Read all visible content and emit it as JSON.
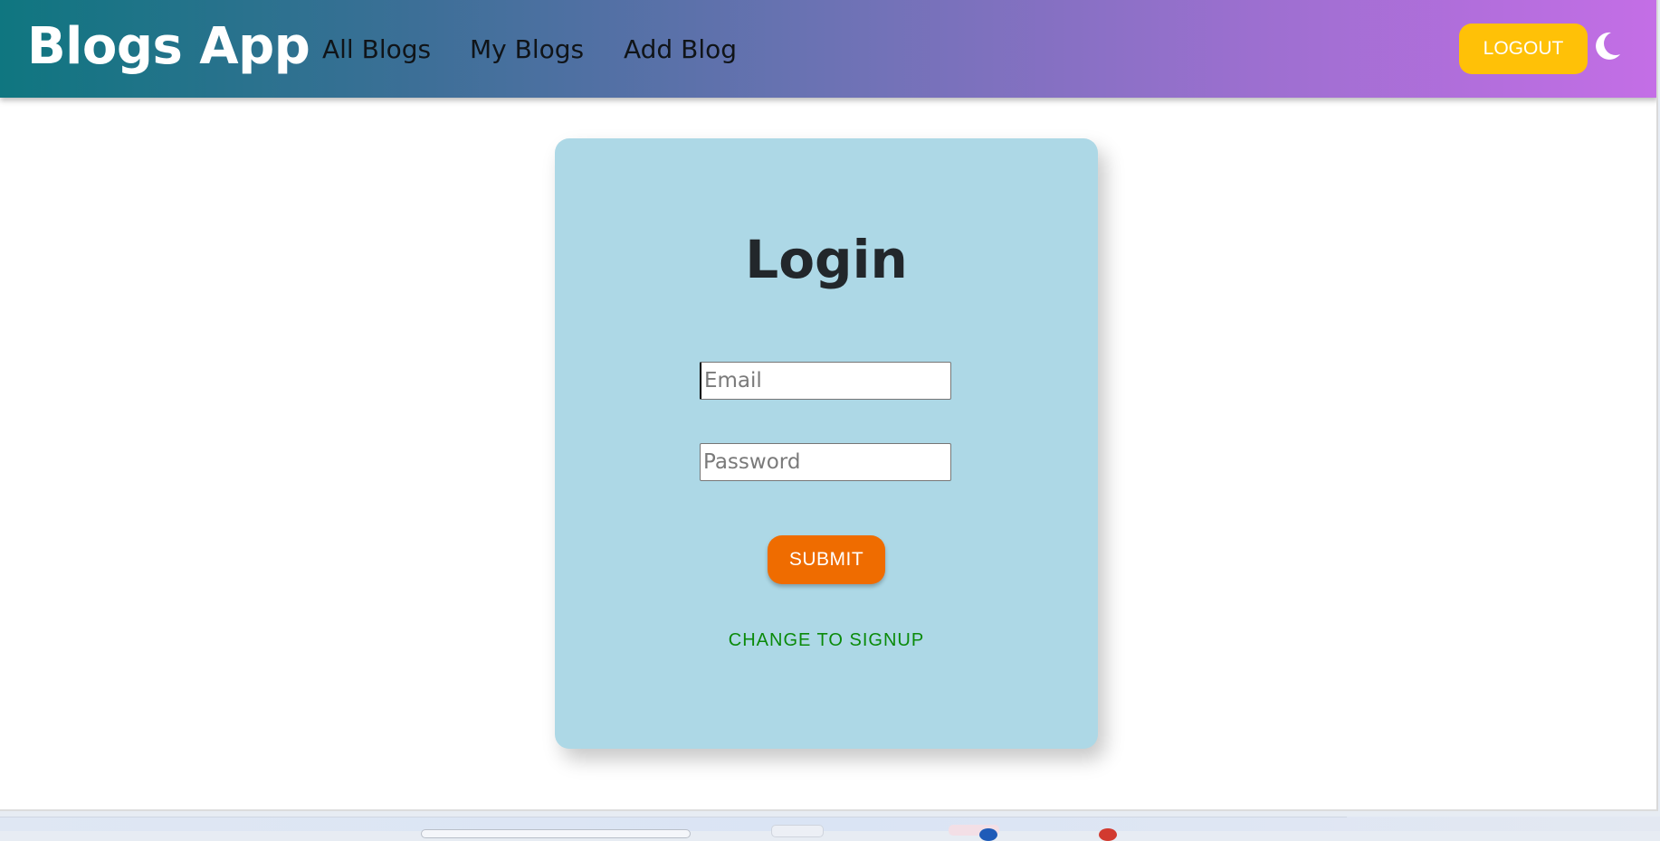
{
  "header": {
    "brand": "Blogs App",
    "nav": {
      "all_blogs": "All Blogs",
      "my_blogs": "My Blogs",
      "add_blog": "Add Blog"
    },
    "logout_label": "LOGOUT",
    "theme_toggle_icon": "moon-icon"
  },
  "login_form": {
    "title": "Login",
    "email_placeholder": "Email",
    "email_value": "",
    "password_placeholder": "Password",
    "password_value": "",
    "submit_label": "SUBMIT",
    "switch_label": "CHANGE TO SIGNUP"
  },
  "colors": {
    "appbar_gradient_start": "#0f7680",
    "appbar_gradient_end": "#c46ee6",
    "logout_button": "#ffc107",
    "card_background": "#add8e6",
    "submit_button": "#ef6c00",
    "switch_link": "#0a8a0a"
  }
}
